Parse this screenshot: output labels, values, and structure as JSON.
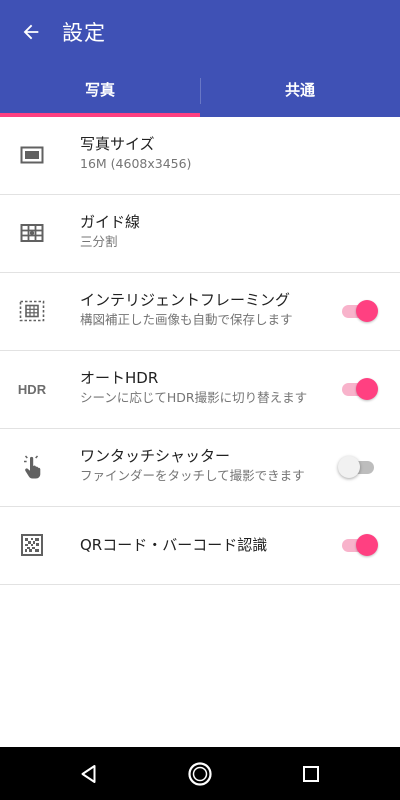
{
  "header": {
    "title": "設定",
    "back_icon": "arrow-back-icon",
    "background": "#3f51b5",
    "tabs": [
      {
        "label": "写真",
        "selected": true
      },
      {
        "label": "共通",
        "selected": false
      }
    ],
    "indicator_color": "#ff4081"
  },
  "settings": {
    "items": [
      {
        "title": "写真サイズ",
        "subtitle": "16M (4608x3456)",
        "icon": "photo-size-icon"
      },
      {
        "title": "ガイド線",
        "subtitle": "三分割",
        "icon": "grid-lines-icon"
      },
      {
        "title": "インテリジェントフレーミング",
        "subtitle": "構図補正した画像も自動で保存します",
        "icon": "intelligent-framing-icon",
        "toggle": true
      },
      {
        "title": "オートHDR",
        "subtitle": "シーンに応じてHDR撮影に切り替えます",
        "icon": "hdr-icon",
        "icon_text": "HDR",
        "toggle": true
      },
      {
        "title": "ワンタッチシャッター",
        "subtitle": "ファインダーをタッチして撮影できます",
        "icon": "touch-shutter-icon",
        "toggle": false
      },
      {
        "title": "QRコード・バーコード認識",
        "icon": "qr-code-icon",
        "toggle": true
      }
    ]
  },
  "colors": {
    "accent": "#ff4081",
    "primary": "#3f51b5"
  },
  "navbar": {
    "buttons": [
      "back-triangle-icon",
      "home-circle-icon",
      "recents-square-icon"
    ]
  }
}
